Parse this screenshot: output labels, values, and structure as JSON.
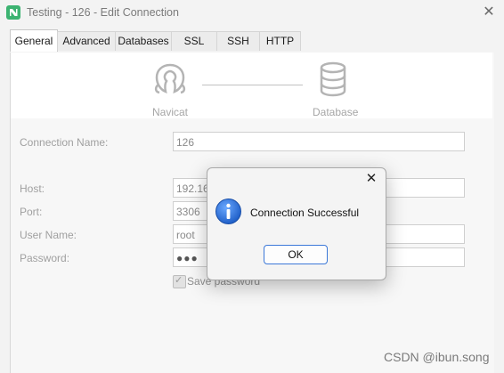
{
  "window": {
    "title": "Testing - 126 - Edit Connection",
    "icon": "navicat-app-icon",
    "close_glyph": "✕"
  },
  "tabs": [
    {
      "label": "General",
      "active": true
    },
    {
      "label": "Advanced",
      "active": false
    },
    {
      "label": "Databases",
      "active": false
    },
    {
      "label": "SSL",
      "active": false
    },
    {
      "label": "SSH",
      "active": false
    },
    {
      "label": "HTTP",
      "active": false
    }
  ],
  "hero": {
    "left_caption": "Navicat",
    "right_caption": "Database",
    "left_icon": "navicat-logo-icon",
    "right_icon": "database-icon"
  },
  "form": {
    "connection_name_label": "Connection Name:",
    "connection_name_value": "126",
    "host_label": "Host:",
    "host_value": "192.168",
    "port_label": "Port:",
    "port_value": "3306",
    "user_label": "User Name:",
    "user_value": "root",
    "password_label": "Password:",
    "password_value": "●●●",
    "save_password_label": "Save password",
    "save_password_checked": true
  },
  "dialog": {
    "message": "Connection Successful",
    "ok_label": "OK",
    "close_glyph": "✕",
    "icon": "info-icon"
  },
  "watermark": "CSDN @ibun.song",
  "colors": {
    "accent": "#3c78d8",
    "info_blue": "#1f5fc8",
    "app_icon": "#3cb371"
  }
}
